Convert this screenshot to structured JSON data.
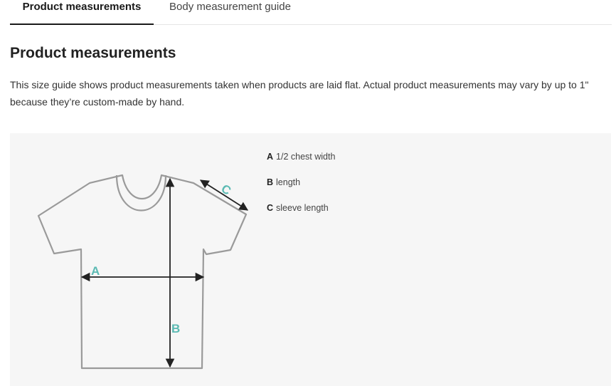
{
  "tabs": {
    "product": "Product measurements",
    "body": "Body measurement guide"
  },
  "main": {
    "title": "Product measurements",
    "description": "This size guide shows product measurements taken when products are laid flat. Actual product measurements may vary by up to 1\" because they’re custom-made by hand."
  },
  "diagram": {
    "labels": {
      "a": "A",
      "b": "B",
      "c": "C"
    },
    "legend": [
      {
        "letter": "A",
        "text": "1/2 chest width"
      },
      {
        "letter": "B",
        "text": "length"
      },
      {
        "letter": "C",
        "text": "sleeve length"
      }
    ],
    "colors": {
      "label": "#5bbab3",
      "outline": "#9a9a9a",
      "arrow": "#222222",
      "panel": "#f6f6f6"
    }
  }
}
